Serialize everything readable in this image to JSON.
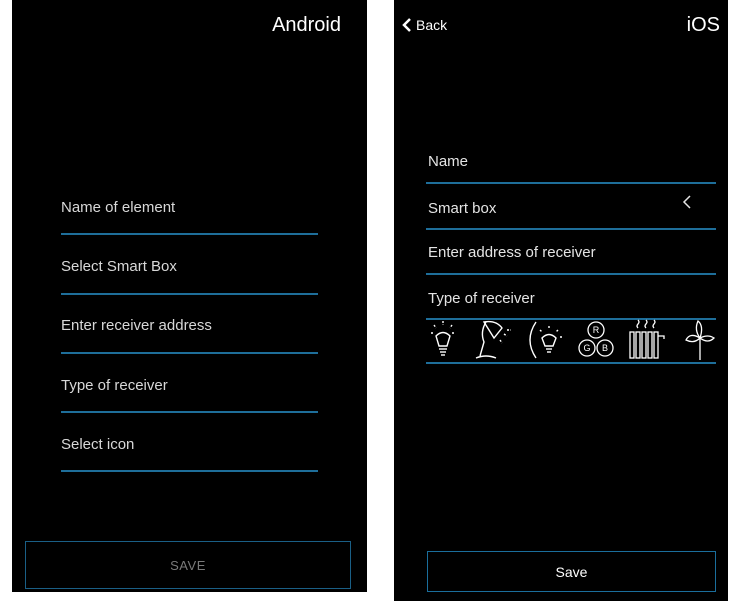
{
  "android": {
    "platform_label": "Android",
    "fields": [
      {
        "label": "Name of element"
      },
      {
        "label": "Select Smart Box"
      },
      {
        "label": "Enter receiver address"
      },
      {
        "label": "Type of receiver"
      },
      {
        "label": "Select icon"
      }
    ],
    "save_label": "SAVE"
  },
  "ios": {
    "platform_label": "iOS",
    "back_label": "Back",
    "fields": [
      {
        "label": "Name"
      },
      {
        "label": "Smart box"
      },
      {
        "label": "Enter address of receiver"
      },
      {
        "label": "Type of receiver"
      }
    ],
    "receiver_icons": [
      "bulb-icon",
      "desk-lamp-icon",
      "dimmable-light-icon",
      "rgb-icon",
      "heater-icon",
      "fan-icon"
    ],
    "save_label": "Save"
  },
  "colors": {
    "background": "#000000",
    "accent_line": "#1e6e9a",
    "text": "#e4e4e4"
  }
}
